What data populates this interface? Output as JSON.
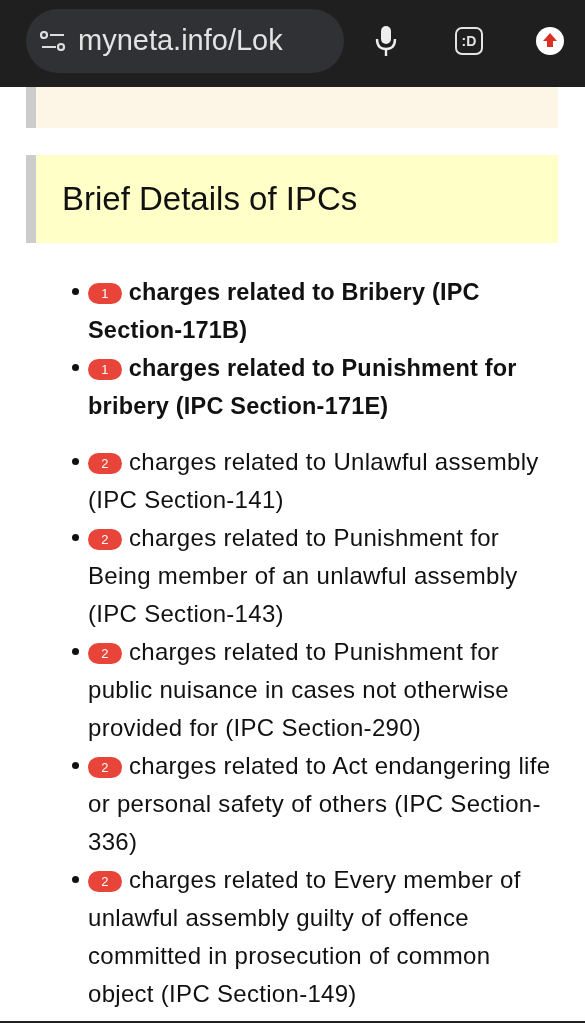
{
  "browser": {
    "url": "myneta.info/Lok",
    "extension_label": ":D"
  },
  "sections": [
    {
      "color": "#fdf5e6"
    },
    {
      "title": "Brief Details of IPCs",
      "color": "#ffffc8"
    }
  ],
  "ipc_groups": [
    {
      "bold": true,
      "items": [
        {
          "count": "1",
          "text": "charges related to Bribery (IPC Section-171B)"
        },
        {
          "count": "1",
          "text": "charges related to Punishment for bribery (IPC Section-171E)"
        }
      ]
    },
    {
      "bold": false,
      "items": [
        {
          "count": "2",
          "text": "charges related to Unlawful assembly (IPC Section-141)"
        },
        {
          "count": "2",
          "text": "charges related to Punishment for Being member of an unlawful assembly (IPC Section-143)"
        },
        {
          "count": "2",
          "text": "charges related to Punishment for public nuisance in cases not otherwise provided for (IPC Section-290)"
        },
        {
          "count": "2",
          "text": "charges related to Act endangering life or personal safety of others (IPC Section-336)"
        },
        {
          "count": "2",
          "text": "charges related to Every member of unlawful assembly guilty of offence committed in prosecution of common object (IPC Section-149)"
        }
      ]
    }
  ]
}
